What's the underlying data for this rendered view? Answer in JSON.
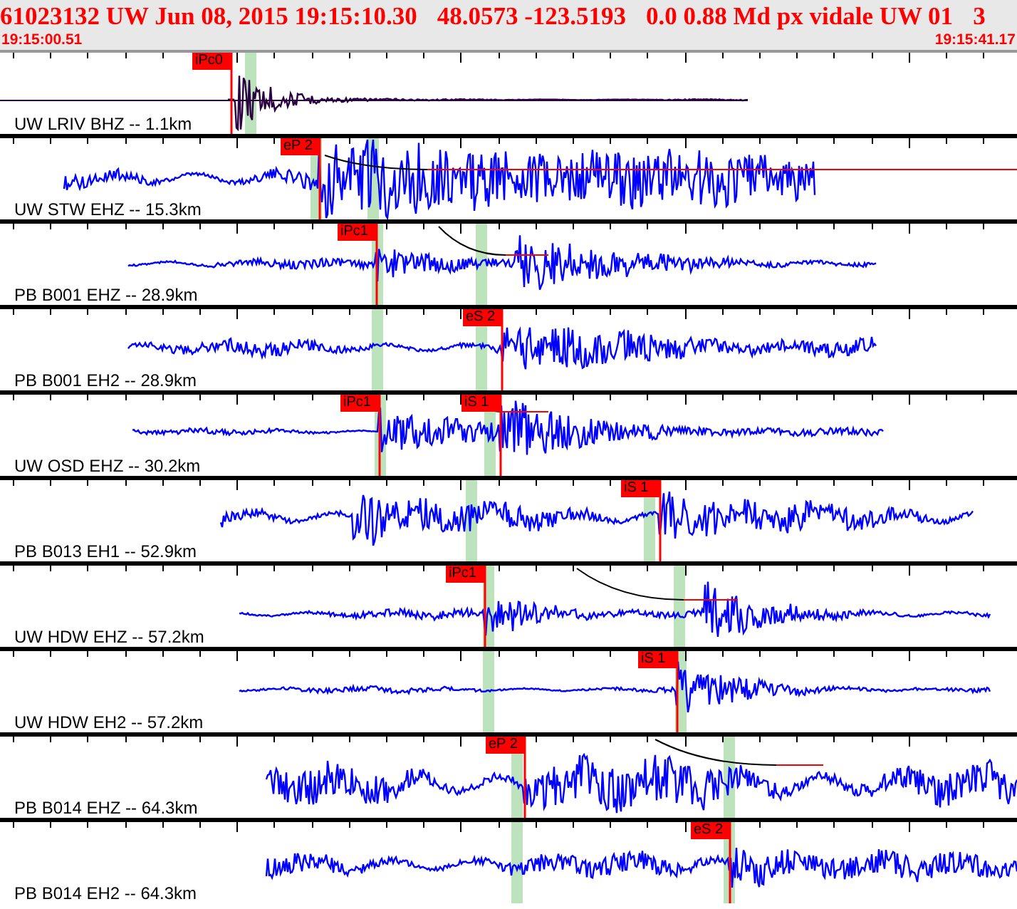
{
  "header": {
    "title_parts": [
      "61023132 UW Jun 08, 2015 19:15:10.30",
      "48.0573 -123.5193",
      "0.0 0.88 Md px vidale UW 01",
      "3"
    ],
    "start_time": "19:15:00.51",
    "end_time": "19:15:41.17"
  },
  "traces": [
    {
      "label": "UW LRIV BHZ -- 1.1km",
      "picks": [
        {
          "label": "iPc0"
        }
      ]
    },
    {
      "label": "UW STW EHZ -- 15.3km",
      "picks": [
        {
          "label": "eP 2"
        }
      ]
    },
    {
      "label": "PB B001 EHZ -- 28.9km",
      "picks": [
        {
          "label": "iPc1"
        }
      ]
    },
    {
      "label": "PB B001 EH2 -- 28.9km",
      "picks": [
        {
          "label": "eS 2"
        }
      ]
    },
    {
      "label": "UW OSD EHZ -- 30.2km",
      "picks": [
        {
          "label": "iPc1"
        },
        {
          "label": "iS 1"
        }
      ]
    },
    {
      "label": "PB B013 EH1 -- 52.9km",
      "picks": [
        {
          "label": "iS 1"
        }
      ]
    },
    {
      "label": "UW HDW EHZ -- 57.2km",
      "picks": [
        {
          "label": "iPc1"
        }
      ]
    },
    {
      "label": "UW HDW EH2 -- 57.2km",
      "picks": [
        {
          "label": "iS 1"
        }
      ]
    },
    {
      "label": "PB B014 EHZ -- 64.3km",
      "picks": [
        {
          "label": "eP 2"
        }
      ]
    },
    {
      "label": "PB B014 EH2 -- 64.3km",
      "picks": [
        {
          "label": "eS 2"
        }
      ]
    }
  ]
}
